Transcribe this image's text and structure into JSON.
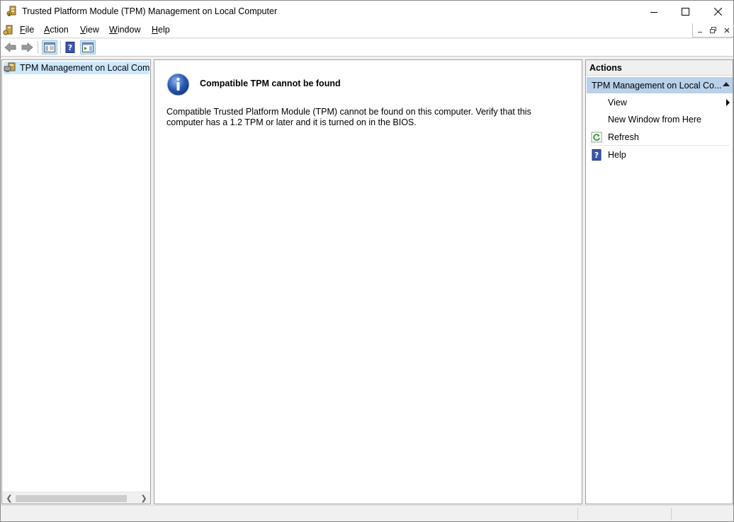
{
  "window": {
    "title": "Trusted Platform Module (TPM) Management on Local Computer"
  },
  "menu": {
    "items": [
      {
        "label": "File",
        "accel": "F",
        "rest": "ile"
      },
      {
        "label": "Action",
        "accel": "A",
        "rest": "ction"
      },
      {
        "label": "View",
        "accel": "V",
        "rest": "iew"
      },
      {
        "label": "Window",
        "accel": "W",
        "rest": "indow"
      },
      {
        "label": "Help",
        "accel": "H",
        "rest": "elp"
      }
    ]
  },
  "tree": {
    "root_label": "TPM Management on Local Comp"
  },
  "main": {
    "message_title": "Compatible TPM cannot be found",
    "message_line1": "Compatible Trusted Platform Module (TPM) cannot be found on this computer. Verify that this",
    "message_line2": "computer has a 1.2 TPM or later and it is turned on in the BIOS."
  },
  "actions": {
    "header": "Actions",
    "section_title": "TPM Management on Local Co...",
    "items": [
      {
        "label": "View",
        "icon": "none",
        "submenu": true
      },
      {
        "label": "New Window from Here",
        "icon": "none",
        "submenu": false
      },
      {
        "label": "Refresh",
        "icon": "refresh-icon",
        "submenu": false
      },
      {
        "label": "Help",
        "icon": "help-icon",
        "submenu": false
      }
    ]
  },
  "colors": {
    "selection": "#cce8ff",
    "section_header": "#b9d1ea",
    "info_blue": "#2a5bb5"
  }
}
